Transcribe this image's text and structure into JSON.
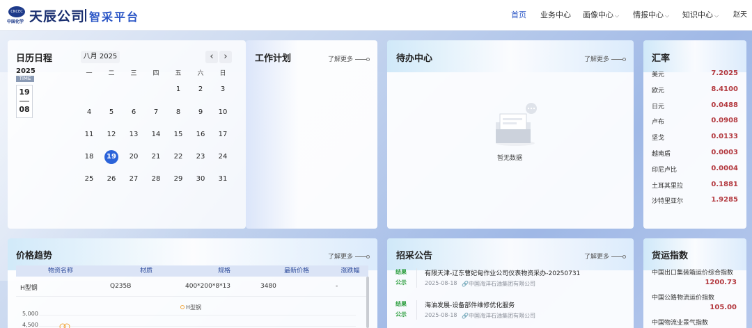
{
  "header": {
    "logo_badge": "中国化学",
    "logo_globe": "CNCEC",
    "brand": "天辰公司",
    "platform": "智采平台",
    "nav": [
      {
        "label": "首页",
        "active": true
      },
      {
        "label": "业务中心"
      },
      {
        "label": "画像中心"
      },
      {
        "label": "情报中心"
      },
      {
        "label": "知识中心"
      }
    ],
    "user": "赵天"
  },
  "calendar": {
    "title": "日历日程",
    "month_label": "八月 2025",
    "prev": "‹",
    "next": "›",
    "year": "2025",
    "time_label": "TIME",
    "date_month": "19",
    "date_day": "08",
    "weekdays": [
      "一",
      "二",
      "三",
      "四",
      "五",
      "六",
      "日"
    ],
    "weeks": [
      [
        "",
        "",
        "",
        "",
        "1",
        "2",
        "3"
      ],
      [
        "4",
        "5",
        "6",
        "7",
        "8",
        "9",
        "10"
      ],
      [
        "11",
        "12",
        "13",
        "14",
        "15",
        "16",
        "17"
      ],
      [
        "18",
        "19",
        "20",
        "21",
        "22",
        "23",
        "24"
      ],
      [
        "25",
        "26",
        "27",
        "28",
        "29",
        "30",
        "31"
      ]
    ],
    "today": "19"
  },
  "work_plan": {
    "title": "工作计划",
    "more": "了解更多"
  },
  "todo": {
    "title": "待办中心",
    "more": "了解更多",
    "empty": "暂无数据"
  },
  "rates": {
    "title": "汇率",
    "items": [
      {
        "name": "美元",
        "value": "7.2025"
      },
      {
        "name": "欧元",
        "value": "8.4100"
      },
      {
        "name": "日元",
        "value": "0.0488"
      },
      {
        "name": "卢布",
        "value": "0.0908"
      },
      {
        "name": "坚戈",
        "value": "0.0133"
      },
      {
        "name": "越南盾",
        "value": "0.0003"
      },
      {
        "name": "印尼卢比",
        "value": "0.0004"
      },
      {
        "name": "土耳其里拉",
        "value": "0.1881"
      },
      {
        "name": "沙特里亚尔",
        "value": "1.9285"
      }
    ]
  },
  "price": {
    "title": "价格趋势",
    "more": "了解更多",
    "columns": [
      "物资名称",
      "材质",
      "规格",
      "最新价格",
      "涨跌幅"
    ],
    "rows": [
      [
        "H型钢",
        "Q235B",
        "400*200*8*13",
        "3480",
        "-"
      ]
    ],
    "chart_legend": "H型钢",
    "y_ticks": [
      "5,000",
      "4,500"
    ]
  },
  "tender": {
    "title": "招采公告",
    "more": "了解更多",
    "items": [
      {
        "tag1": "结果",
        "tag2": "公示",
        "title": "有限天津-辽东曹妃甸作业公司仪表物资采办-20250731",
        "date": "2025-08-18",
        "org": "中国海洋石油集团有限公司"
      },
      {
        "tag1": "结果",
        "tag2": "公示",
        "title": "海油发展-设备部件维修优化服务",
        "date": "2025-08-18",
        "org": "中国海洋石油集团有限公司"
      }
    ]
  },
  "freight": {
    "title": "货运指数",
    "items": [
      {
        "name": "中国出口集装箱运价综合指数",
        "value": "1200.73"
      },
      {
        "name": "中国公路物流运价指数",
        "value": "105.00"
      },
      {
        "name": "中国物流业景气指数",
        "value": ""
      }
    ]
  },
  "colors": {
    "accent": "#2b63d9",
    "value_red": "#b3393f",
    "tag_green": "#2a9d3c"
  }
}
